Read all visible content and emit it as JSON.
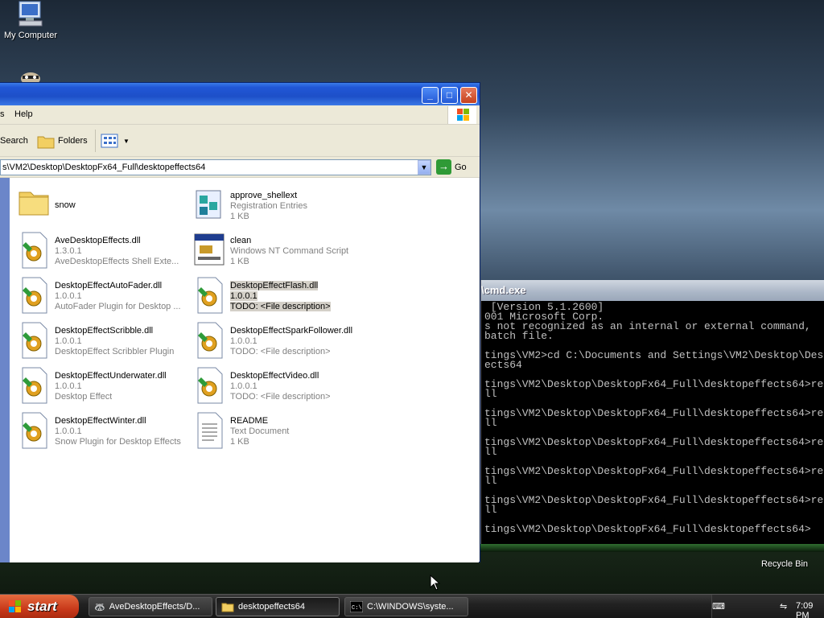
{
  "desktop": {
    "my_computer_label": "My Computer",
    "recycle_bin_label": "Recycle Bin"
  },
  "explorer": {
    "menu": {
      "help": "Help"
    },
    "toolbar": {
      "search": "Search",
      "folders": "Folders"
    },
    "address": {
      "path": "s\\VM2\\Desktop\\DesktopFx64_Full\\desktopeffects64",
      "go": "Go"
    },
    "files": [
      {
        "name": "snow",
        "line2": "",
        "line3": "",
        "icon": "folder-icon"
      },
      {
        "name": "approve_shellext",
        "line2": "Registration Entries",
        "line3": "1 KB",
        "icon": "registry-icon"
      },
      {
        "name": "AveDesktopEffects.dll",
        "line2": "1.3.0.1",
        "line3": "AveDesktopEffects Shell Exte...",
        "icon": "dll-icon"
      },
      {
        "name": "clean",
        "line2": "Windows NT Command Script",
        "line3": "1 KB",
        "icon": "script-icon"
      },
      {
        "name": "DesktopEffectAutoFader.dll",
        "line2": "1.0.0.1",
        "line3": "AutoFader Plugin for Desktop ...",
        "icon": "dll-icon"
      },
      {
        "name": "DesktopEffectFlash.dll",
        "line2": "1.0.0.1",
        "line3": "TODO: <File description>",
        "icon": "dll-icon"
      },
      {
        "name": "DesktopEffectScribble.dll",
        "line2": "1.0.0.1",
        "line3": "DesktopEffect Scribbler Plugin",
        "icon": "dll-icon"
      },
      {
        "name": "DesktopEffectSparkFollower.dll",
        "line2": "1.0.0.1",
        "line3": "TODO: <File description>",
        "icon": "dll-icon"
      },
      {
        "name": "DesktopEffectUnderwater.dll",
        "line2": "1.0.0.1",
        "line3": "Desktop Effect",
        "icon": "dll-icon"
      },
      {
        "name": "DesktopEffectVideo.dll",
        "line2": "1.0.0.1",
        "line3": "TODO: <File description>",
        "icon": "dll-icon"
      },
      {
        "name": "DesktopEffectWinter.dll",
        "line2": "1.0.0.1",
        "line3": "Snow Plugin for Desktop Effects",
        "icon": "dll-icon"
      },
      {
        "name": "README",
        "line2": "Text Document",
        "line3": "1 KB",
        "icon": "text-document-icon"
      }
    ]
  },
  "cmd": {
    "title": "\\cmd.exe",
    "lines": [
      " [Version 5.1.2600]",
      "001 Microsoft Corp.",
      "s not recognized as an internal or external command,",
      "batch file.",
      "",
      "tings\\VM2>cd C:\\Documents and Settings\\VM2\\Desktop\\Des",
      "ects64",
      "",
      "tings\\VM2\\Desktop\\DesktopFx64_Full\\desktopeffects64>re",
      "ll",
      "",
      "tings\\VM2\\Desktop\\DesktopFx64_Full\\desktopeffects64>re",
      "ll",
      "",
      "tings\\VM2\\Desktop\\DesktopFx64_Full\\desktopeffects64>re",
      "ll",
      "",
      "tings\\VM2\\Desktop\\DesktopFx64_Full\\desktopeffects64>re",
      "ll",
      "",
      "tings\\VM2\\Desktop\\DesktopFx64_Full\\desktopeffects64>re",
      "ll",
      "",
      "tings\\VM2\\Desktop\\DesktopFx64_Full\\desktopeffects64>"
    ]
  },
  "taskbar": {
    "start": "start",
    "tasks": [
      {
        "label": "AveDesktopEffects/D...",
        "active": false
      },
      {
        "label": "desktopeffects64",
        "active": true
      },
      {
        "label": "C:\\WINDOWS\\syste...",
        "active": false
      }
    ],
    "clock": "7:09 PM"
  }
}
